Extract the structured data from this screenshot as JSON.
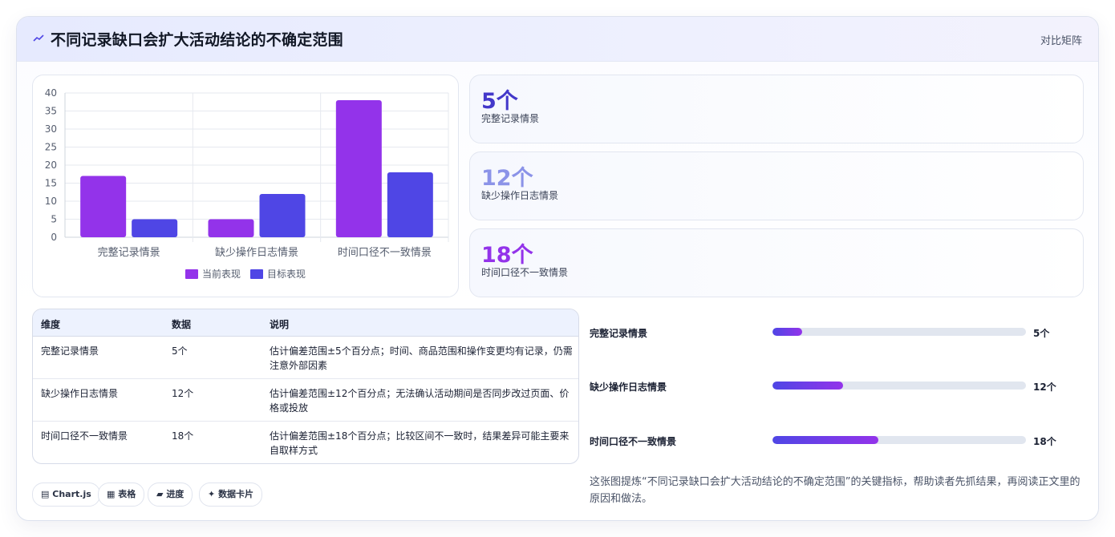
{
  "header": {
    "icon": "trend-icon",
    "title": "不同记录缺口会扩大活动结论的不确定范围",
    "tag": "对比矩阵"
  },
  "chart_data": {
    "type": "bar",
    "categories": [
      "完整记录情景",
      "缺少操作日志情景",
      "时间口径不一致情景"
    ],
    "series": [
      {
        "name": "当前表现",
        "values": [
          17,
          5,
          38
        ],
        "color": "#9333ea"
      },
      {
        "name": "目标表现",
        "values": [
          5,
          12,
          18
        ],
        "color": "#4f46e5"
      }
    ],
    "ylim": [
      0,
      40
    ],
    "yticks": [
      0,
      5,
      10,
      15,
      20,
      25,
      30,
      35,
      40
    ],
    "grid": true,
    "legend": "bottom"
  },
  "stats": [
    {
      "value": "5个",
      "label": "完整记录情景",
      "color": "#4338ca"
    },
    {
      "value": "12个",
      "label": "缺少操作日志情景",
      "color": "#8b93e8"
    },
    {
      "value": "18个",
      "label": "时间口径不一致情景",
      "color": "#9333ea"
    }
  ],
  "table": {
    "headers": [
      "维度",
      "数据",
      "说明"
    ],
    "rows": [
      {
        "dim": "完整记录情景",
        "data": "5个",
        "desc": "估计偏差范围±5个百分点；时间、商品范围和操作变更均有记录，仍需注意外部因素"
      },
      {
        "dim": "缺少操作日志情景",
        "data": "12个",
        "desc": "估计偏差范围±12个百分点；无法确认活动期间是否同步改过页面、价格或投放"
      },
      {
        "dim": "时间口径不一致情景",
        "data": "18个",
        "desc": "估计偏差范围±18个百分点；比较区间不一致时，结果差异可能主要来自取样方式"
      }
    ]
  },
  "progress": [
    {
      "label": "完整记录情景",
      "value": 5,
      "display": "5个",
      "max": 43
    },
    {
      "label": "缺少操作日志情景",
      "value": 12,
      "display": "12个",
      "max": 43
    },
    {
      "label": "时间口径不一致情景",
      "value": 18,
      "display": "18个",
      "max": 43
    }
  ],
  "chips": [
    {
      "icon": "chart-icon",
      "glyph": "▤",
      "label": "Chart.js"
    },
    {
      "icon": "table-icon",
      "glyph": "▦",
      "label": "表格"
    },
    {
      "icon": "progress-icon",
      "glyph": "▰",
      "label": "进度"
    },
    {
      "icon": "sparkle-icon",
      "glyph": "✦",
      "label": "数据卡片"
    }
  ],
  "note": "这张图提炼“不同记录缺口会扩大活动结论的不确定范围”的关键指标，帮助读者先抓结果，再阅读正文里的原因和做法。"
}
